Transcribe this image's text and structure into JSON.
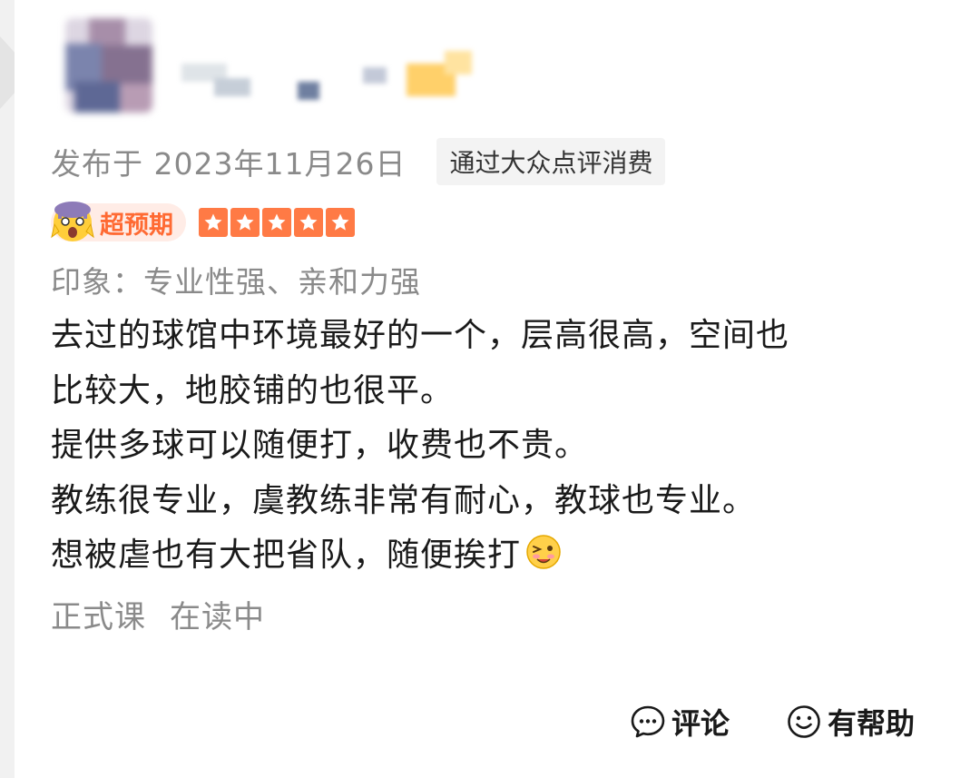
{
  "review": {
    "published": "发布于 2023年11月26日",
    "source_tag": "通过大众点评消费",
    "badge_label": "超预期",
    "star_rating": 5,
    "impression": "印象：专业性强、亲和力强",
    "content_lines": [
      "去过的球馆中环境最好的一个，层高很高，空间也",
      "比较大，地胶铺的也很平。",
      "提供多球可以随便打，收费也不贵。",
      "教练很专业，虞教练非常有耐心，教球也专业。",
      "想被虐也有大把省队，随便挨打"
    ],
    "course_type": "正式课",
    "course_status": "在读中"
  },
  "actions": {
    "comment_label": "评论",
    "helpful_label": "有帮助"
  },
  "icons": {
    "badge_icon": "shocked-face-icon",
    "star_icon": "star-icon",
    "line_end_emoji": "wink-face-emoji",
    "comment_icon": "comment-bubble-icon",
    "helpful_icon": "smile-icon"
  },
  "colors": {
    "accent": "#ff6a33",
    "star": "#ff7a45",
    "meta_text": "#8a8a8a",
    "body_text": "#1a1a1a"
  }
}
